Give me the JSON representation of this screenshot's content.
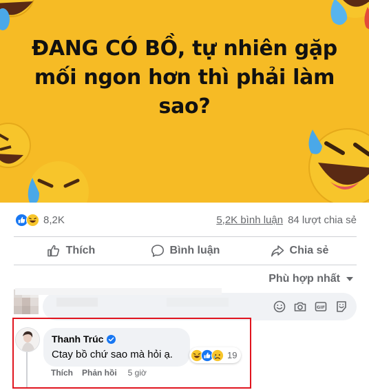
{
  "post": {
    "image_headline": "ĐANG CÓ BỒ, tự nhiên gặp mối ngon hơn thì phải làm sao?",
    "image_background": "#f6bb25",
    "reaction_icons": [
      "like-icon",
      "haha-icon"
    ],
    "reaction_count": "8,2K",
    "comment_count": "5,2K bình luận",
    "share_count": "84 lượt chia sẻ"
  },
  "actions": {
    "like_label": "Thích",
    "comment_label": "Bình luận",
    "share_label": "Chia sẻ"
  },
  "sort": {
    "label": "Phù hợp nhất"
  },
  "composer": {
    "tool_icons": [
      "smiley-icon",
      "camera-icon",
      "gif-icon",
      "sticker-icon"
    ]
  },
  "comment": {
    "author": "Thanh Trúc",
    "verified": true,
    "text": "Ctay bồ chứ sao mà hỏi ạ.",
    "reaction_icons": [
      "haha-icon",
      "like-icon",
      "sad-icon"
    ],
    "reaction_count": "19",
    "like_label": "Thích",
    "reply_label": "Phản hồi",
    "time": "5 giờ"
  },
  "colors": {
    "facebook_blue": "#1877f2",
    "secondary_text": "#65676b",
    "highlight_border": "#e0141e"
  }
}
